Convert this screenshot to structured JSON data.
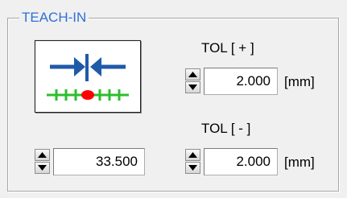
{
  "group": {
    "title": "TEACH-IN"
  },
  "teach_button": {
    "icon": "teach-in-icon"
  },
  "tol_plus": {
    "label": "TOL [ + ]",
    "value": "2.000",
    "unit": "[mm]"
  },
  "tol_minus": {
    "label": "TOL [ - ]",
    "value": "2.000",
    "unit": "[mm]"
  },
  "position": {
    "value": "33.500"
  },
  "colors": {
    "title": "#2f6fd6",
    "arrow": "#1f5aa8",
    "scale": "#2ebd2e",
    "marker": "#ff0000"
  }
}
